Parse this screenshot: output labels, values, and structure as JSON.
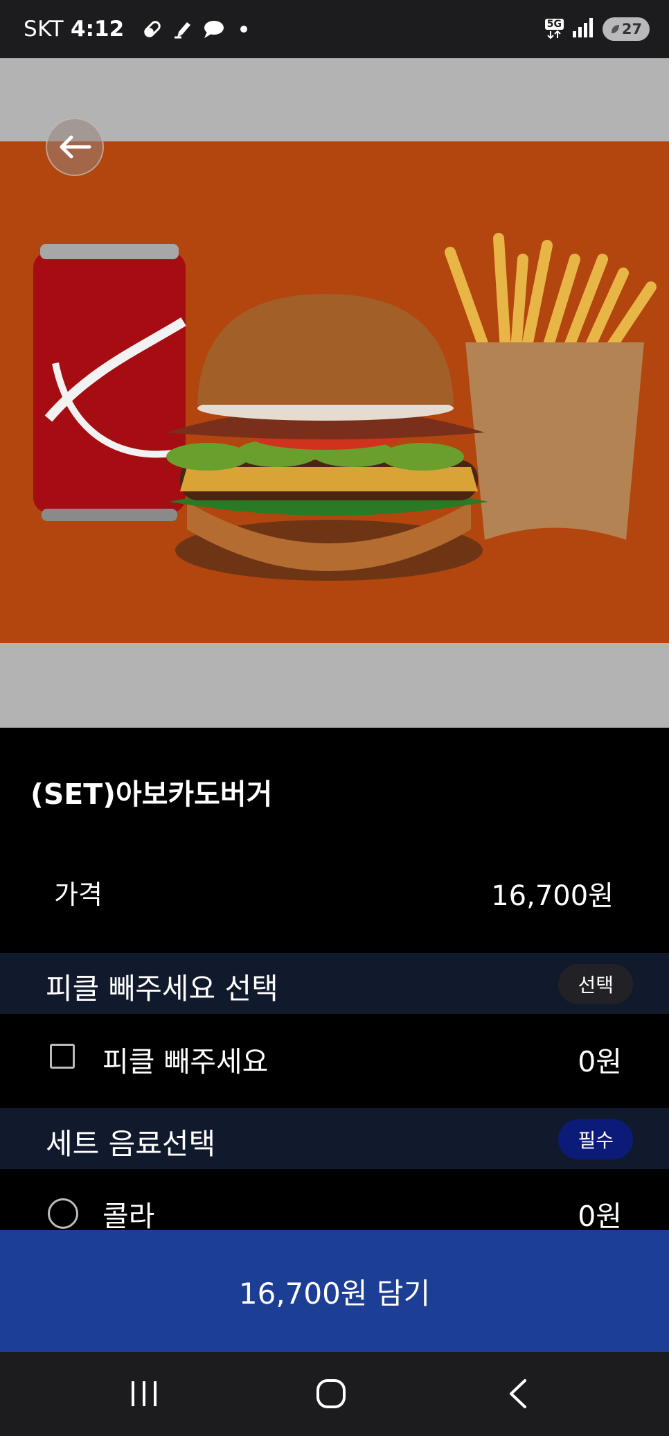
{
  "status_bar": {
    "carrier": "SKT",
    "time": "4:12",
    "notification_icons": [
      "pill-icon",
      "pen-icon",
      "chat-bubble-icon",
      "dot-icon"
    ],
    "network": "5G",
    "battery": "27"
  },
  "product": {
    "title": "(SET)아보카도버거",
    "price_label": "가격",
    "price_value": "16,700원"
  },
  "sections": [
    {
      "title": "피클 빼주세요 선택",
      "badge": "선택",
      "options": [
        {
          "label": "피클 빼주세요",
          "price": "0원",
          "control": "checkbox"
        }
      ]
    },
    {
      "title": "세트 음료선택",
      "badge": "필수",
      "options": [
        {
          "label": "콜라",
          "price": "0원",
          "control": "radio"
        }
      ]
    }
  ],
  "cta": {
    "label": "16,700원 담기"
  },
  "colors": {
    "section_header_bg": "#111a2d",
    "required_badge": "#0c1b78",
    "cta_bg": "#1c3e94",
    "hero_orange": "#b3450f"
  }
}
